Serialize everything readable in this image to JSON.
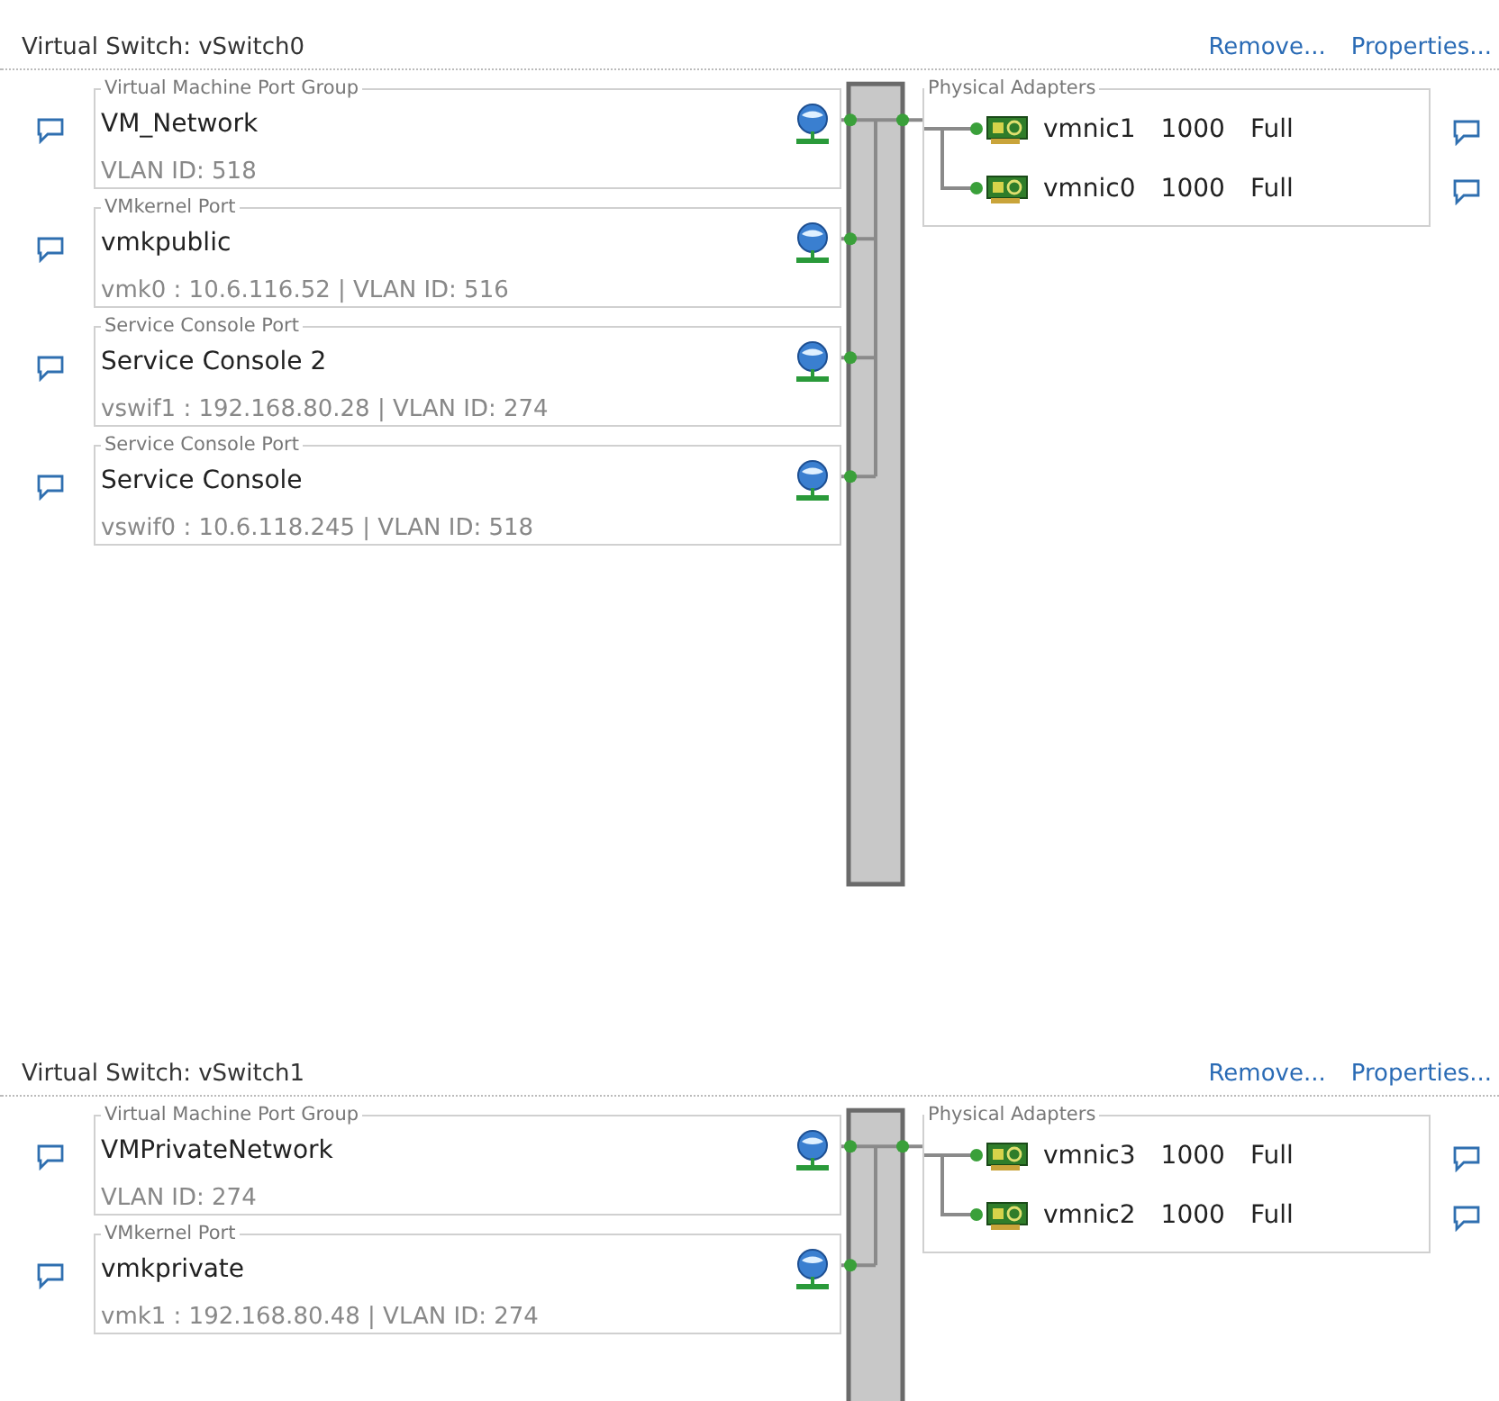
{
  "switches": [
    {
      "title": "Virtual Switch: vSwitch0",
      "actions": [
        "Remove...",
        "Properties..."
      ],
      "port_groups": [
        {
          "type": "Virtual Machine Port Group",
          "name": "VM_Network",
          "details": "VLAN ID: 518"
        },
        {
          "type": "VMkernel Port",
          "name": "vmkpublic",
          "details": "vmk0 : 10.6.116.52 | VLAN ID: 516"
        },
        {
          "type": "Service Console Port",
          "name": "Service Console 2",
          "details": "vswif1 : 192.168.80.28 | VLAN ID: 274"
        },
        {
          "type": "Service Console Port",
          "name": "Service Console",
          "details": "vswif0 : 10.6.118.245 | VLAN ID: 518"
        }
      ],
      "adapters_title": "Physical Adapters",
      "adapters": [
        {
          "name": "vmnic1",
          "speed": "1000",
          "duplex": "Full"
        },
        {
          "name": "vmnic0",
          "speed": "1000",
          "duplex": "Full"
        }
      ]
    },
    {
      "title": "Virtual Switch: vSwitch1",
      "actions": [
        "Remove...",
        "Properties..."
      ],
      "port_groups": [
        {
          "type": "Virtual Machine Port Group",
          "name": "VMPrivateNetwork",
          "details": "VLAN ID: 274"
        },
        {
          "type": "VMkernel Port",
          "name": "vmkprivate",
          "details": "vmk1 : 192.168.80.48 | VLAN ID: 274"
        }
      ],
      "adapters_title": "Physical Adapters",
      "adapters": [
        {
          "name": "vmnic3",
          "speed": "1000",
          "duplex": "Full"
        },
        {
          "name": "vmnic2",
          "speed": "1000",
          "duplex": "Full"
        }
      ]
    }
  ]
}
